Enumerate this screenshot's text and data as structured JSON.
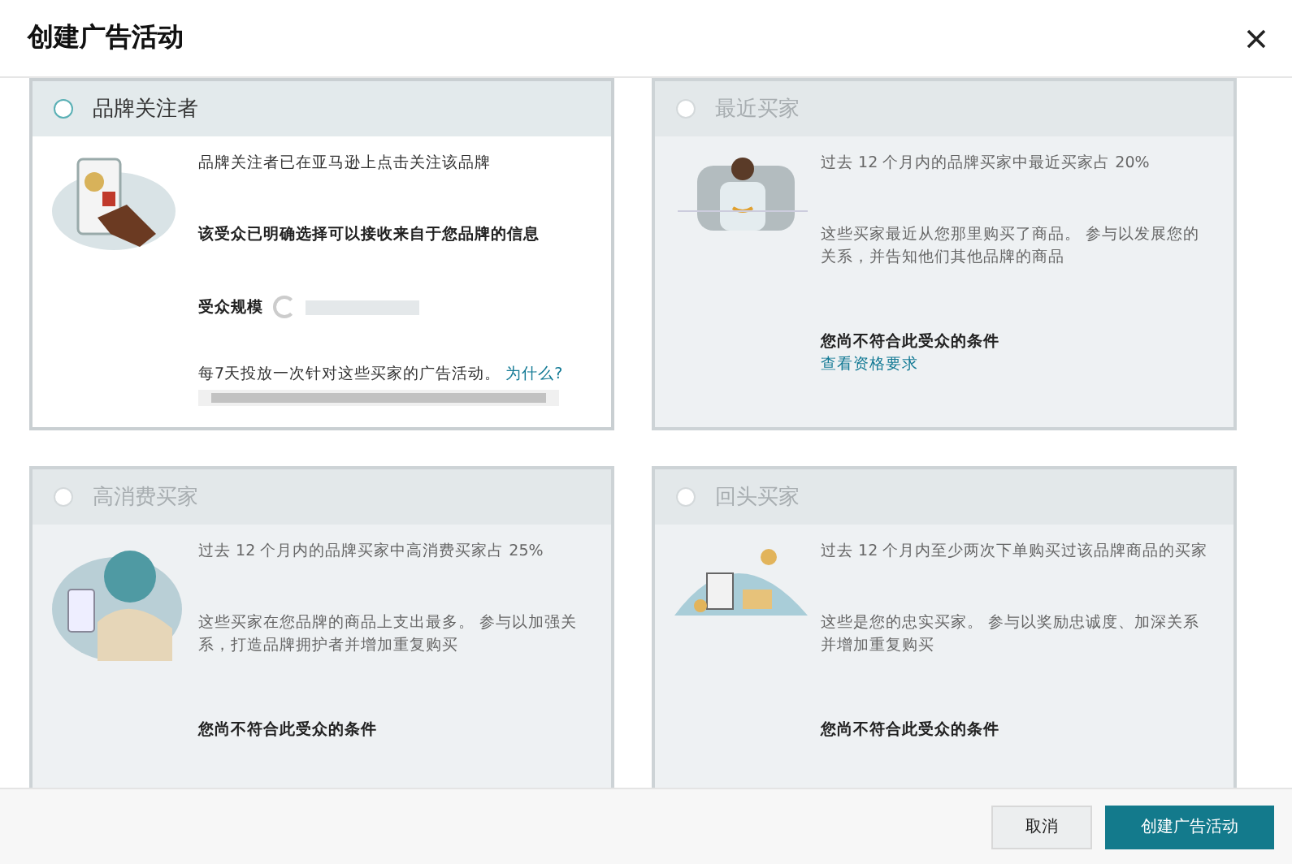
{
  "dialog": {
    "title": "创建广告活动"
  },
  "audiences": [
    {
      "kind": "followers",
      "title": "品牌关注者",
      "selected": false,
      "disabled": false,
      "description": "品牌关注者已在亚马逊上点击关注该品牌",
      "highlight": "该受众已明确选择可以接收来自于您品牌的信息",
      "size_label": "受众规模",
      "note": "每7天投放一次针对这些买家的广告活动。",
      "note_link": "为什么?"
    },
    {
      "kind": "recent",
      "title": "最近买家",
      "selected": false,
      "disabled": true,
      "description": "过去 12 个月内的品牌买家中最近买家占 20%",
      "detail": "这些买家最近从您那里购买了商品。 参与以发展您的关系，并告知他们其他品牌的商品",
      "ineligible": "您尚不符合此受众的条件",
      "link": "查看资格要求"
    },
    {
      "kind": "high-spend",
      "title": "高消费买家",
      "selected": false,
      "disabled": true,
      "description": "过去 12 个月内的品牌买家中高消费买家占 25%",
      "detail": "这些买家在您品牌的商品上支出最多。 参与以加强关系，打造品牌拥护者并增加重复购买",
      "ineligible": "您尚不符合此受众的条件"
    },
    {
      "kind": "repeat",
      "title": "回头买家",
      "selected": false,
      "disabled": true,
      "description": "过去 12 个月内至少两次下单购买过该品牌商品的买家",
      "detail": "这些是您的忠实买家。 参与以奖励忠诚度、加深关系并增加重复购买",
      "ineligible": "您尚不符合此受众的条件"
    }
  ],
  "footer": {
    "buttons": [
      {
        "label": "取消",
        "kind": "secondary"
      },
      {
        "label": "创建广告活动",
        "kind": "primary"
      }
    ]
  }
}
